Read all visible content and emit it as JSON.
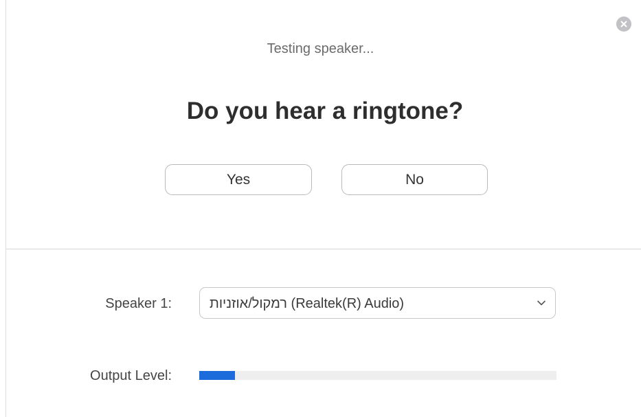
{
  "dialog": {
    "status_text": "Testing speaker...",
    "question": "Do you hear a ringtone?",
    "yes_label": "Yes",
    "no_label": "No",
    "close_icon": "close-icon"
  },
  "speaker": {
    "label": "Speaker 1:",
    "selected_device": "רמקול/אוזניות (Realtek(R) Audio)",
    "dropdown_icon": "chevron-down-icon"
  },
  "output": {
    "label": "Output Level:",
    "level_fraction": 0.1
  },
  "colors": {
    "level_fill": "#1c6ddb",
    "close_button": "#c2c2c6"
  }
}
